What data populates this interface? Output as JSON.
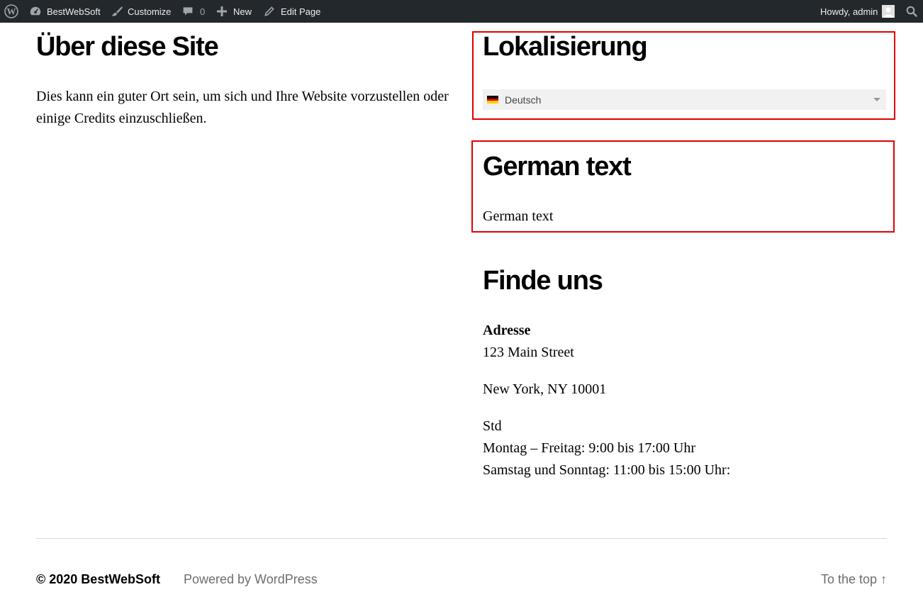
{
  "admin_bar": {
    "site_name": "BestWebSoft",
    "customize_label": "Customize",
    "comments_count": "0",
    "new_label": "New",
    "edit_page_label": "Edit Page",
    "howdy_label": "Howdy, admin",
    "icons": [
      "wordpress-icon",
      "dashboard-icon",
      "brush-icon",
      "comment-icon",
      "plus-icon",
      "pencil-icon",
      "avatar",
      "search-icon"
    ],
    "background_color": "#23282d"
  },
  "main": {
    "title": "Über diese Site",
    "intro": "Dies kann ein guter Ort sein, um sich und Ihre Website vorzustellen oder einige Credits einzuschließen."
  },
  "widgets": {
    "localization": {
      "title": "Lokalisierung",
      "selected_language": "Deutsch",
      "flag": "german-flag-icon"
    },
    "german_text": {
      "title": "German text",
      "body": "German text"
    },
    "find_us": {
      "title": "Finde uns",
      "address_heading": "Adresse",
      "address_line1": "123 Main Street",
      "address_line2": "New York, NY 10001",
      "hours_heading": "Std",
      "hours_weekdays": "Montag – Freitag: 9:00 bis 17:00 Uhr",
      "hours_weekend": "Samstag und Sonntag: 11:00 bis 15:00 Uhr:"
    },
    "highlight_color": "#e00000"
  },
  "footer": {
    "copyright": "© 2020 BestWebSoft",
    "powered_by": "Powered by WordPress",
    "to_top": "To the top ↑"
  }
}
